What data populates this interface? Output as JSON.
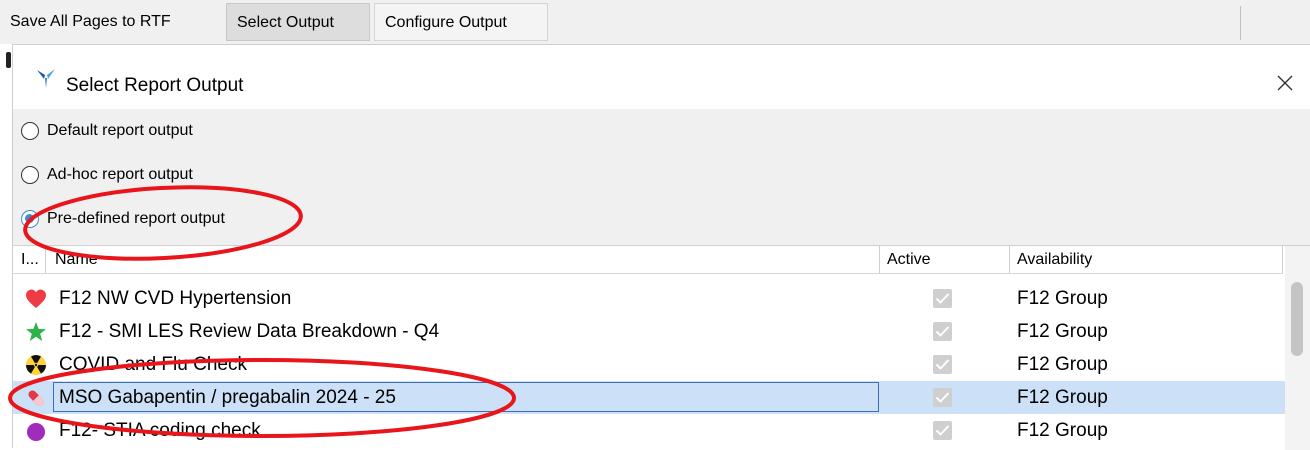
{
  "toolbar": {
    "save_rtf": "Save All Pages to RTF",
    "select_output": "Select Output",
    "configure_output": "Configure Output"
  },
  "dialog": {
    "title": "Select Report Output",
    "icon": "app-logo-icon",
    "close_icon": "close-icon"
  },
  "options": [
    {
      "label": "Default report output",
      "checked": false
    },
    {
      "label": "Ad-hoc report output",
      "checked": false
    },
    {
      "label": "Pre-defined report output",
      "checked": true
    }
  ],
  "table": {
    "columns": {
      "icon": "I...",
      "name": "Name",
      "active": "Active",
      "availability": "Availability"
    },
    "rows": [
      {
        "icon": "heart-icon",
        "name": "F12 NW CVD Hypertension",
        "active": true,
        "availability": "F12 Group",
        "selected": false
      },
      {
        "icon": "star-icon",
        "name": "F12 - SMI LES Review Data Breakdown - Q4",
        "active": true,
        "availability": "F12 Group",
        "selected": false
      },
      {
        "icon": "radiation-icon",
        "name": "COVID and Flu Check",
        "active": true,
        "availability": "F12 Group",
        "selected": false
      },
      {
        "icon": "pill-icon",
        "name": "MSO Gabapentin / pregabalin 2024 - 25",
        "active": true,
        "availability": "F12 Group",
        "selected": true
      },
      {
        "icon": "circle-icon",
        "name": "F12- STIA coding check",
        "active": true,
        "availability": "F12 Group",
        "selected": false
      }
    ]
  },
  "colors": {
    "annotation": "#e8151b",
    "selection": "#cce0f7",
    "radio_checked": "#3a8ed1"
  }
}
